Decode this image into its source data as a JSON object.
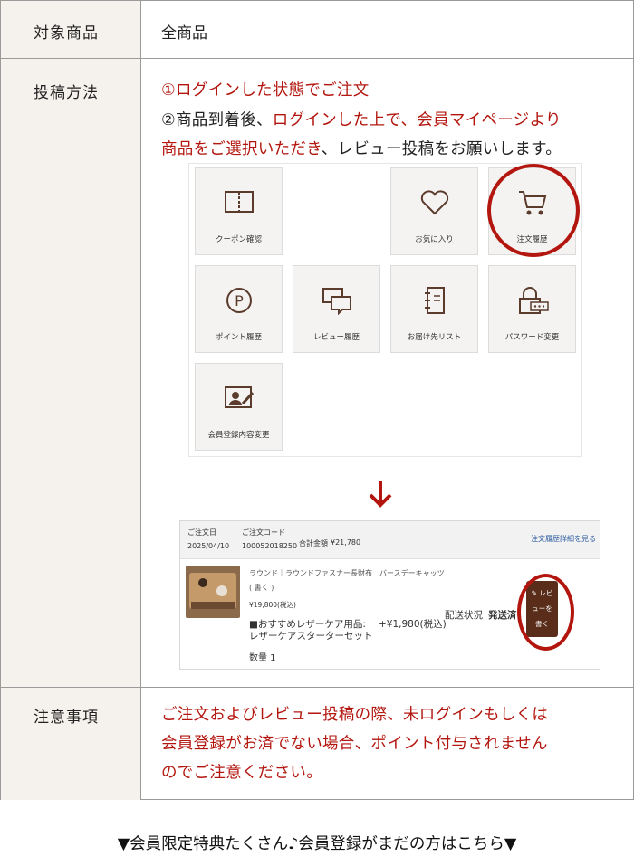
{
  "rows": [
    {
      "label": "対象商品",
      "value": "全商品"
    },
    {
      "label": "投稿方法"
    },
    {
      "label": "注意事項"
    }
  ],
  "method": {
    "l1_red": "①ログインした状態でご注文",
    "l2_black1": "②商品到着後、",
    "l2_red": "ログインした上で、会員マイページより",
    "l3_red": "商品をご選択いただき",
    "l3_black": "、レビュー投稿をお願いします。"
  },
  "mypage_tiles": [
    {
      "label": "クーポン確認",
      "icon": "coupon-book-icon"
    },
    {
      "label": "お気に入り",
      "icon": "heart-icon"
    },
    {
      "label": "注文履歴",
      "icon": "cart-icon"
    },
    {
      "label": "ポイント履歴",
      "icon": "point-icon"
    },
    {
      "label": "レビュー履歴",
      "icon": "chat-icon"
    },
    {
      "label": "お届け先リスト",
      "icon": "address-book-icon"
    },
    {
      "label": "パスワード変更",
      "icon": "lock-icon"
    },
    {
      "label": "会員登録内容変更",
      "icon": "profile-edit-icon"
    }
  ],
  "order": {
    "date_label": "ご注文日",
    "date": "2025/04/10",
    "code_label": "ご注文コード",
    "code": "100052018250",
    "total_label": "合計金額",
    "total": "¥21,780",
    "detail_link": "注文履歴詳細を見る",
    "product_name": "ラウンド｜ラウンドファスナー長財布　バースデーキャッツ",
    "write_short": "( 書く )",
    "product_price": "¥19,800(税込)",
    "addon": "■おすすめレザーケア用品:",
    "addon2": "レザーケアスターターセット",
    "addon_price": "+¥1,980(税込)",
    "ship_status_label": "配送状況",
    "ship_status": "発送済",
    "qty": "数量 1",
    "review_btn_l1": "✎ レビ",
    "review_btn_l2": "ューを",
    "review_btn_l3": "書く"
  },
  "notice": {
    "l1": "ご注文およびレビュー投稿の際、未ログインもしくは",
    "l2": "会員登録がお済でない場合、ポイント付与されません",
    "l3": "のでご注意ください。"
  },
  "footer": "▼会員限定特典たくさん♪会員登録がまだの方はこちら▼",
  "colors": {
    "accent_red": "#b3160e",
    "header_bg": "#f5f1ec",
    "icon_brown": "#5a3b2c"
  }
}
